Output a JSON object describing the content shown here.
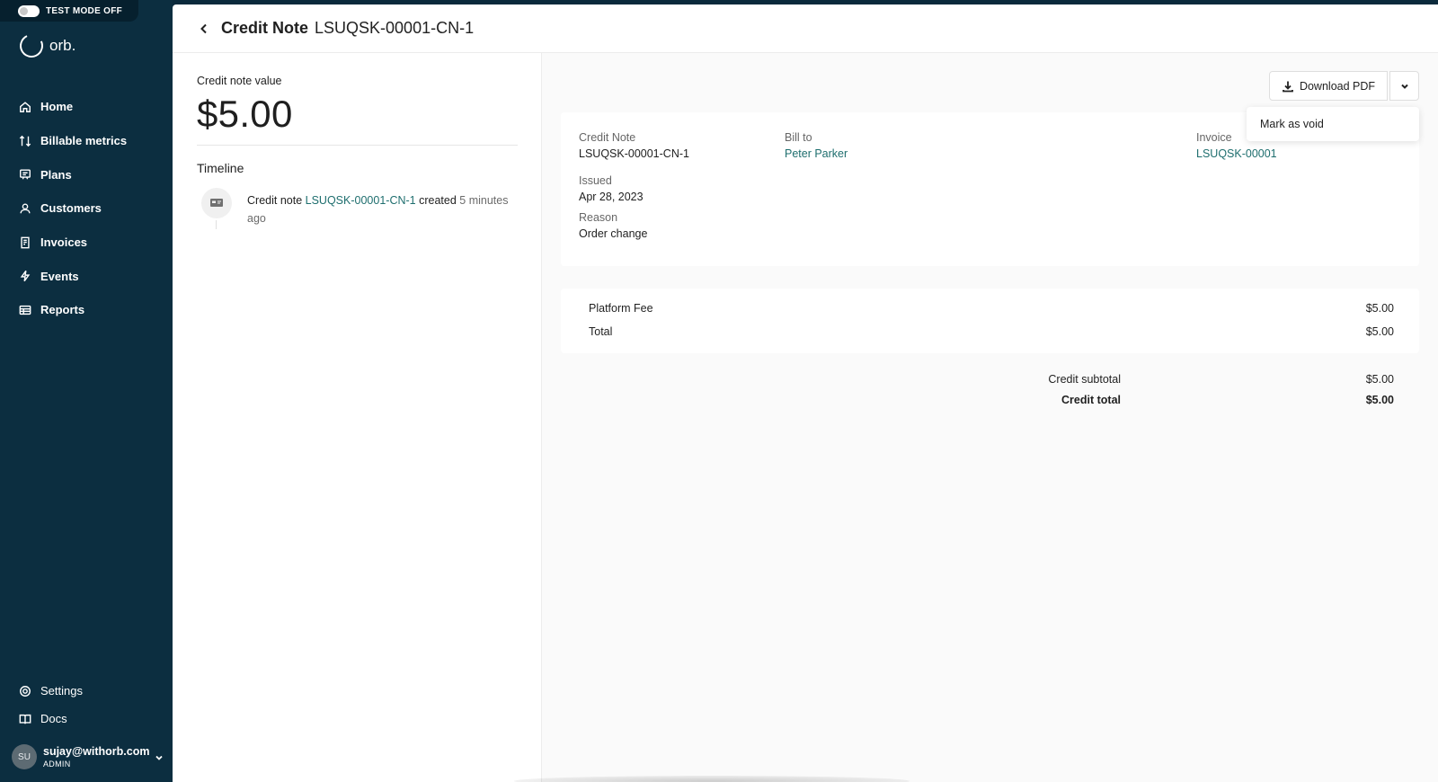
{
  "test_mode": {
    "label": "TEST MODE OFF"
  },
  "brand": {
    "name": "orb."
  },
  "nav": {
    "items": [
      {
        "label": "Home",
        "icon": "home-icon"
      },
      {
        "label": "Billable metrics",
        "icon": "arrows-updown-icon"
      },
      {
        "label": "Plans",
        "icon": "plans-icon"
      },
      {
        "label": "Customers",
        "icon": "users-icon"
      },
      {
        "label": "Invoices",
        "icon": "receipt-icon"
      },
      {
        "label": "Events",
        "icon": "bolt-icon"
      },
      {
        "label": "Reports",
        "icon": "table-icon"
      }
    ],
    "bottom": [
      {
        "label": "Settings",
        "icon": "gear-icon"
      },
      {
        "label": "Docs",
        "icon": "book-icon"
      }
    ]
  },
  "user": {
    "initials": "SU",
    "email": "sujay@withorb.com",
    "role": "ADMIN"
  },
  "header": {
    "title": "Credit Note",
    "id": "LSUQSK-00001-CN-1"
  },
  "summary": {
    "value_label": "Credit note value",
    "value": "$5.00",
    "timeline_title": "Timeline",
    "event": {
      "prefix": "Credit note",
      "link": "LSUQSK-00001-CN-1",
      "verb": "created",
      "time": "5 minutes ago"
    }
  },
  "actions": {
    "download": "Download PDF",
    "menu_item": "Mark as void"
  },
  "details": {
    "credit_note_label": "Credit Note",
    "credit_note_value": "LSUQSK-00001-CN-1",
    "bill_to_label": "Bill to",
    "bill_to_value": "Peter Parker",
    "invoice_label": "Invoice",
    "invoice_value": "LSUQSK-00001",
    "issued_label": "Issued",
    "issued_value": "Apr 28, 2023",
    "reason_label": "Reason",
    "reason_value": "Order change"
  },
  "line_items": [
    {
      "label": "Platform Fee",
      "amount": "$5.00"
    },
    {
      "label": "Total",
      "amount": "$5.00"
    }
  ],
  "totals": {
    "subtotal_label": "Credit subtotal",
    "subtotal": "$5.00",
    "total_label": "Credit total",
    "total": "$5.00"
  },
  "colors": {
    "sidebar": "#0c2e40",
    "link": "#1e6e6e"
  }
}
